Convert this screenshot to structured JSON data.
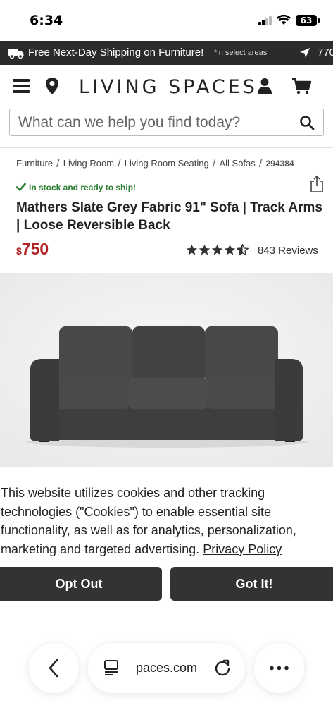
{
  "status_bar": {
    "time": "6:34",
    "battery": "63"
  },
  "promo": {
    "text": "Free Next-Day Shipping on Furniture!",
    "sub": "*in select areas",
    "zip": "770"
  },
  "header": {
    "logo": "LIVING SPACES"
  },
  "search": {
    "placeholder": "What can we help you find today?"
  },
  "breadcrumb": {
    "items": [
      "Furniture",
      "Living Room",
      "Living Room Seating",
      "All Sofas"
    ],
    "sku": "294384"
  },
  "product": {
    "stock": "In stock and ready to ship!",
    "title": "Mathers Slate Grey Fabric 91\" Sofa | Track Arms | Loose Reversible Back",
    "currency": "$",
    "price": "750",
    "rating": 4.5,
    "reviews": "843 Reviews"
  },
  "cookie": {
    "text": "This website utilizes cookies and other tracking technologies (\"Cookies\") to enable essential site functionality, as well as for analytics, personalization, marketing and targeted advertising.",
    "privacy_link": "Privacy Policy",
    "opt_out": "Opt Out",
    "got_it": "Got It!"
  },
  "browser": {
    "url": "paces.com"
  },
  "colors": {
    "accent_price": "#b22222",
    "stock_green": "#2e7d32",
    "promo_bg": "#2b2b2b",
    "button_bg": "#333333"
  },
  "icons": [
    "truck-icon",
    "location-arrow-icon",
    "menu-icon",
    "location-pin-icon",
    "user-icon",
    "cart-icon",
    "search-icon",
    "check-icon",
    "share-icon",
    "star-icon",
    "back-icon",
    "reader-icon",
    "reload-icon",
    "more-icon"
  ]
}
